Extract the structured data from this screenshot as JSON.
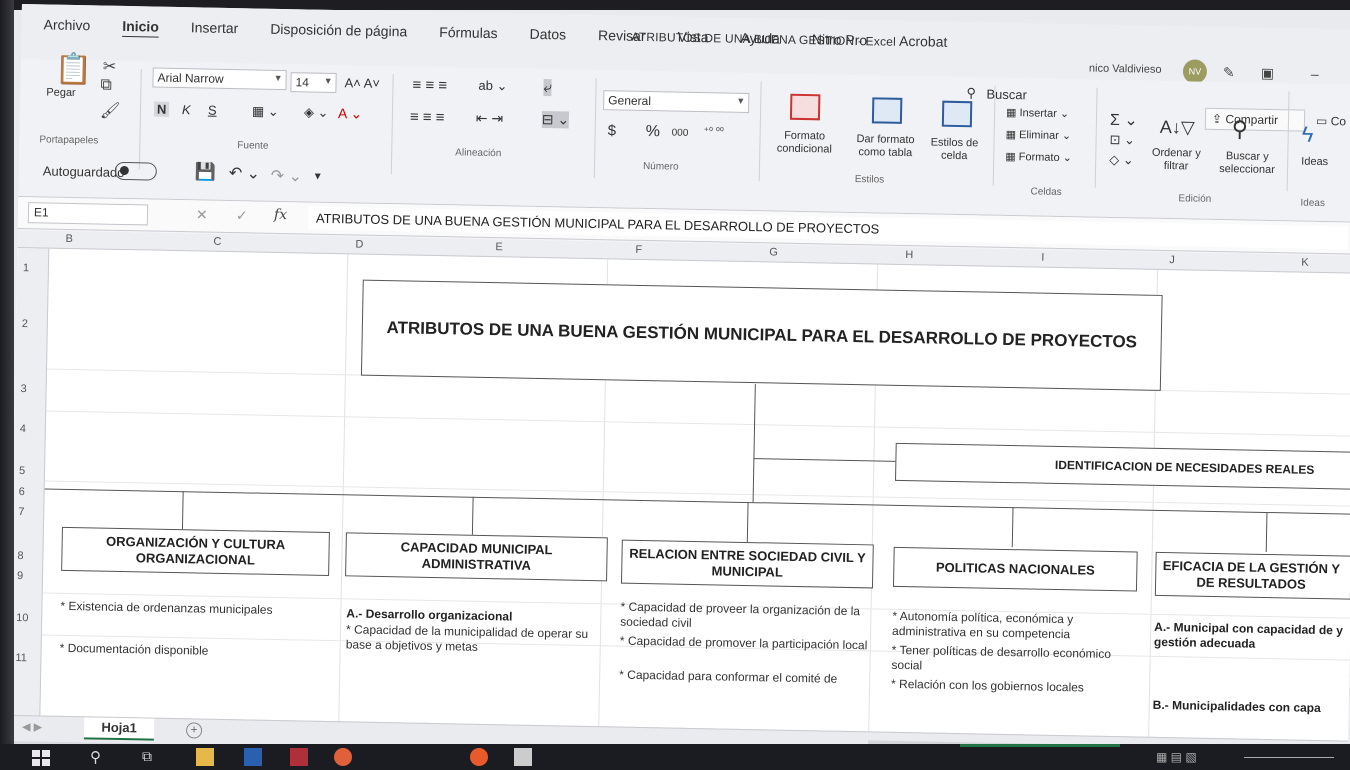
{
  "window": {
    "title": "ATRIBUTOS DE UNA BUENA GESTION  -  Excel",
    "user_name": "nico Valdivieso",
    "user_initials": "NV"
  },
  "tabs": [
    "Archivo",
    "Inicio",
    "Insertar",
    "Disposición de página",
    "Fórmulas",
    "Datos",
    "Revisar",
    "Vista",
    "Ayuda",
    "Nitro Pro",
    "Acrobat"
  ],
  "search_label": "Buscar",
  "share_label": "Compartir",
  "comments_label": "Co",
  "ribbon": {
    "portapapeles": {
      "label": "Portapapeles",
      "paste": "Pegar"
    },
    "fuente": {
      "label": "Fuente",
      "font": "Arial Narrow",
      "size": "14",
      "bold": "N",
      "italic": "K",
      "underline": "S"
    },
    "alineacion": {
      "label": "Alineación"
    },
    "numero": {
      "label": "Número",
      "format": "General",
      "currency": "$",
      "percent": "%",
      "thousands": "000"
    },
    "estilos": {
      "label": "Estilos",
      "cond_format": "Formato\ncondicional",
      "as_table": "Dar formato\ncomo tabla",
      "cell_styles": "Estilos de\ncelda"
    },
    "celdas": {
      "label": "Celdas",
      "insert": "Insertar",
      "delete": "Eliminar",
      "format": "Formato"
    },
    "edicion": {
      "label": "Edición",
      "sort": "Ordenar y\nfiltrar",
      "find": "Buscar y\nseleccionar"
    },
    "ideas": {
      "label": "Ideas",
      "button": "Ideas"
    }
  },
  "quick_access": {
    "autosave": "Autoguardado"
  },
  "formula_bar": {
    "name_box": "E1",
    "fx": "fx",
    "content": "ATRIBUTOS DE UNA BUENA GESTIÓN MUNICIPAL PARA EL DESARROLLO DE PROYECTOS"
  },
  "columns": [
    "B",
    "C",
    "D",
    "E",
    "F",
    "G",
    "H",
    "I",
    "J",
    "K"
  ],
  "rows": [
    "1",
    "2",
    "3",
    "4",
    "5",
    "6",
    "7",
    "8",
    "9",
    "10",
    "11"
  ],
  "sheet": {
    "main_title": "ATRIBUTOS DE UNA BUENA GESTIÓN MUNICIPAL PARA EL DESARROLLO DE PROYECTOS",
    "needs_box": "IDENTIFICACION DE NECESIDADES REALES",
    "categories": [
      "ORGANIZACIÓN Y CULTURA ORGANIZACIONAL",
      "CAPACIDAD MUNICIPAL ADMINISTRATIVA",
      "RELACION ENTRE SOCIEDAD CIVIL Y MUNICIPAL",
      "POLITICAS NACIONALES",
      "EFICACIA DE LA GESTIÓN Y DE RESULTADOS"
    ],
    "col1_items": [
      "* Existencia de ordenanzas municipales",
      "* Documentación disponible"
    ],
    "col2_heading": "A.- Desarrollo organizacional",
    "col2_items": [
      "* Capacidad de la municipalidad de operar su base a objetivos y metas"
    ],
    "col3_items": [
      "* Capacidad de proveer la organización de la sociedad civil",
      "* Capacidad de promover la participación local",
      "* Capacidad para conformar el comité de"
    ],
    "col4_items": [
      "* Autonomía política, económica y administrativa en su competencia",
      "* Tener políticas de desarrollo económico social",
      "* Relación con los gobiernos locales"
    ],
    "col5_items": [
      "A.- Municipal con capacidad de y gestión adecuada",
      "B.- Municipalidades con capa"
    ]
  },
  "sheet_tab": "Hoja1",
  "add_sheet": "+"
}
